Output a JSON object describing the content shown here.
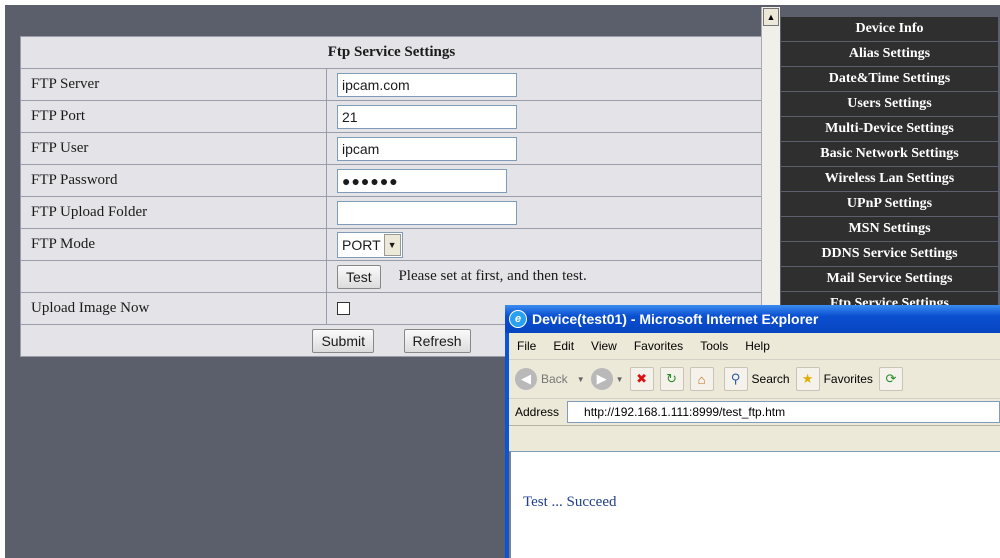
{
  "settings": {
    "title": "Ftp Service Settings",
    "rows": {
      "server": {
        "label": "FTP Server",
        "value": "ipcam.com"
      },
      "port": {
        "label": "FTP Port",
        "value": "21"
      },
      "user": {
        "label": "FTP User",
        "value": "ipcam"
      },
      "password": {
        "label": "FTP Password",
        "value": "●●●●●●"
      },
      "folder": {
        "label": "FTP Upload Folder",
        "value": ""
      },
      "mode": {
        "label": "FTP Mode",
        "value": "PORT"
      },
      "upload_now": {
        "label": "Upload Image Now",
        "checked": false
      }
    },
    "test_button": "Test",
    "test_hint": "Please set at first, and then test.",
    "submit_button": "Submit",
    "refresh_button": "Refresh"
  },
  "menu": [
    "Device Info",
    "Alias Settings",
    "Date&Time Settings",
    "Users Settings",
    "Multi-Device Settings",
    "Basic Network Settings",
    "Wireless Lan Settings",
    "UPnP Settings",
    "MSN Settings",
    "DDNS Service Settings",
    "Mail Service Settings",
    "Ftp Service Settings"
  ],
  "popup": {
    "title": "Device(test01) - Microsoft Internet Explorer",
    "menubar": [
      "File",
      "Edit",
      "View",
      "Favorites",
      "Tools",
      "Help"
    ],
    "toolbar": {
      "back": "Back",
      "search": "Search",
      "favorites": "Favorites"
    },
    "address_label": "Address",
    "address": "http://192.168.1.111:8999/test_ftp.htm",
    "message": "Test ... Succeed"
  },
  "colors": {
    "menu_bg": "#2f2f2f",
    "panel_bg": "#5b5e6b",
    "table_bg": "#e4e4e8",
    "ie_blue": "#0a54d8"
  }
}
